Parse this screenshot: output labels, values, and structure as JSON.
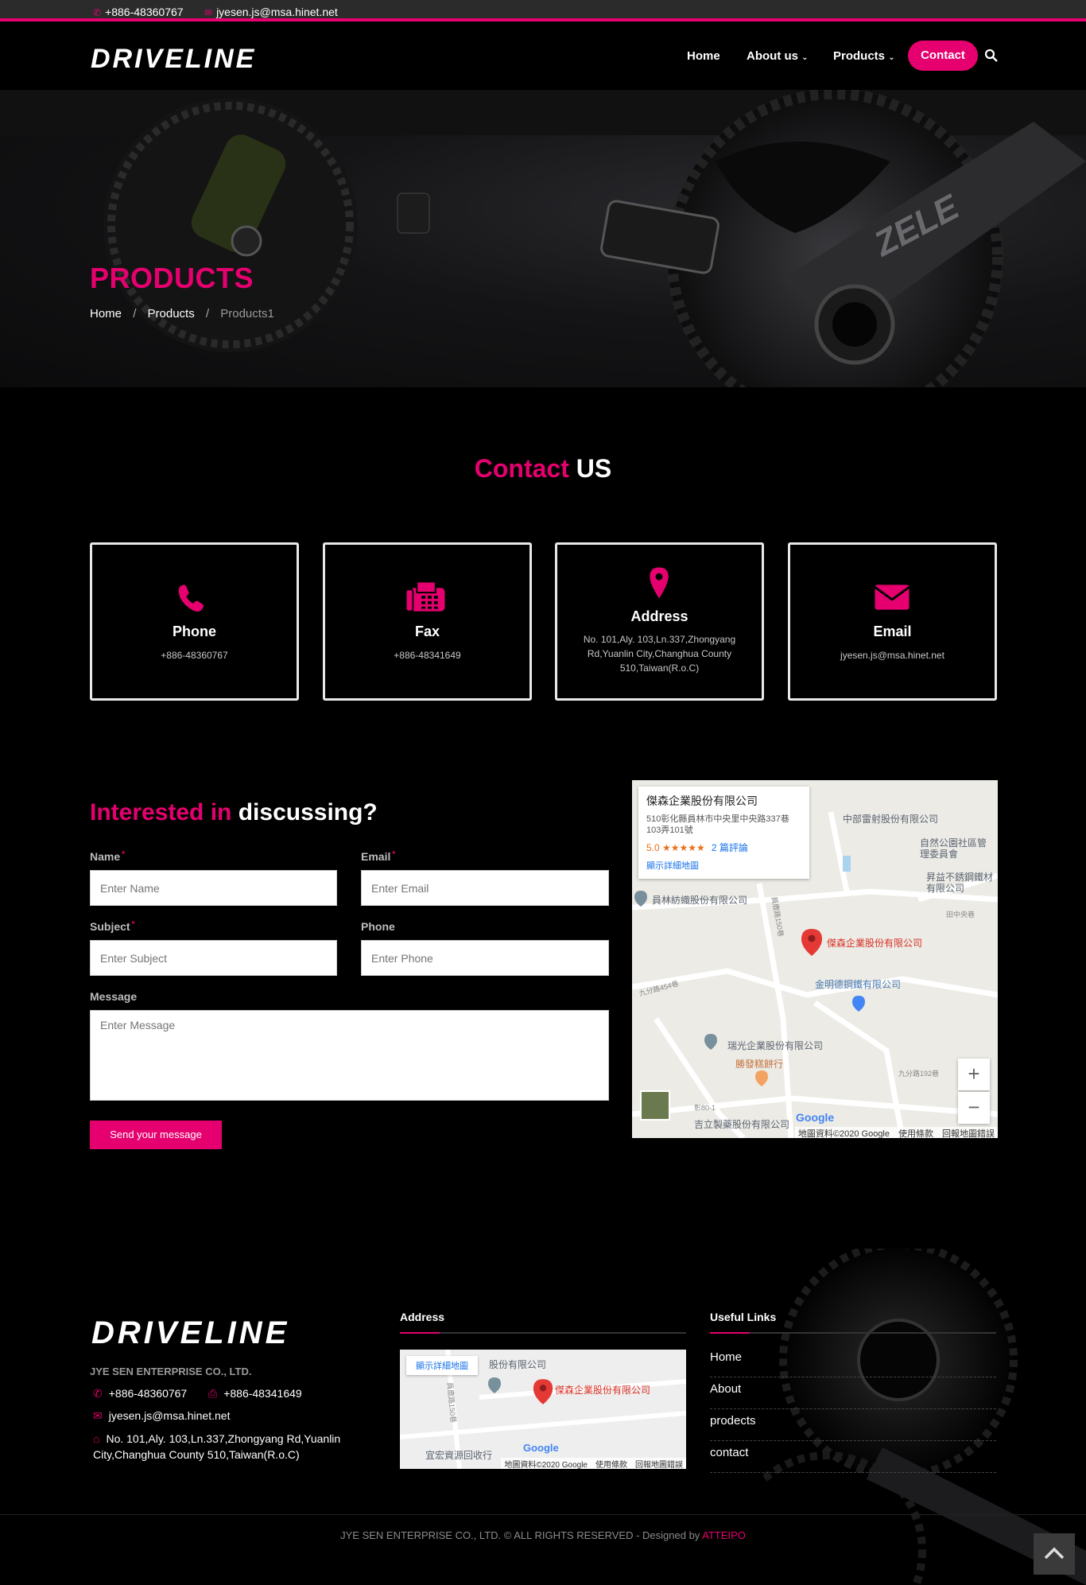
{
  "topbar": {
    "phone": "+886-48360767",
    "email": "jyesen.js@msa.hinet.net"
  },
  "header": {
    "logo_text": "DRIVELINE",
    "nav": {
      "home": "Home",
      "about": "About us",
      "products": "Products",
      "contact": "Contact"
    }
  },
  "hero": {
    "title": "PRODUCTS",
    "breadcrumb": [
      "Home",
      "Products",
      "Products1"
    ],
    "separator": "/"
  },
  "contact_heading": {
    "accent": "Contact",
    "rest": "US"
  },
  "cards": [
    {
      "title": "Phone",
      "value": "+886-48360767",
      "icon": "phone-icon"
    },
    {
      "title": "Fax",
      "value": "+886-48341649",
      "icon": "fax-icon"
    },
    {
      "title": "Address",
      "value": "No. 101,Aly. 103,Ln.337,Zhongyang Rd,Yuanlin City,Changhua County 510,Taiwan(R.o.C)",
      "icon": "map-pin-icon"
    },
    {
      "title": "Email",
      "value": "jyesen.js@msa.hinet.net",
      "icon": "envelope-icon"
    }
  ],
  "form": {
    "heading_accent": "Interested in",
    "heading_rest": "discussing?",
    "name_label": "Name",
    "name_placeholder": "Enter Name",
    "email_label": "Email",
    "email_placeholder": "Enter Email",
    "subject_label": "Subject",
    "subject_placeholder": "Enter Subject",
    "phone_label": "Phone",
    "phone_placeholder": "Enter Phone",
    "message_label": "Message",
    "message_placeholder": "Enter Message",
    "required_mark": "*",
    "submit": "Send your message"
  },
  "map": {
    "place_name": "傑森企業股份有限公司",
    "place_address": "510彰化縣員林市中央里中央路337巷103弄101號",
    "rating": "5.0 ★★★★★",
    "reviews": "2 篇評論",
    "details_link": "顯示詳細地圖",
    "labels": {
      "zhongbu": "中部雷射股份有限公司",
      "ziran": "自然公園社區管理委員會",
      "shengyi": "昇益不銹鋼鐵材有限公司",
      "tianzhong": "田中央巷",
      "yuanlin": "員林紡織股份有限公司",
      "marker": "傑森企業股份有限公司",
      "jinming": "金明德鋼鐵有限公司",
      "ruiguang": "瑞光企業股份有限公司",
      "shengfa": "勝發糕餅行",
      "jili": "吉立製藥股份有限公司"
    },
    "roads": {
      "r1": "員鹿路150巷",
      "r2": "九分路454巷",
      "r3": "九分路192巷",
      "r4": "彰80-1"
    },
    "zoom_in": "+",
    "zoom_out": "−",
    "google": "Google",
    "footer_text": "地圖資料©2020 Google　使用條款　回報地圖錯誤"
  },
  "footer": {
    "logo_text": "DRIVELINE",
    "company": "JYE SEN ENTERPRISE CO., LTD.",
    "phone": "+886-48360767",
    "fax": "+886-48341649",
    "email": "jyesen.js@msa.hinet.net",
    "address": "No. 101,Aly. 103,Ln.337,Zhongyang Rd,Yuanlin City,Changhua County 510,Taiwan(R.o.C)",
    "address_title": "Address",
    "mini_map": {
      "details_link": "顯示詳細地圖",
      "partial": "股份有限公司",
      "marker": "傑森企業股份有限公司",
      "road": "員鹿路150巷",
      "bottom": "宜宏資源回收行",
      "google": "Google",
      "footer_text": "地圖資料©2020 Google　使用條款　回報地圖錯誤"
    },
    "links_title": "Useful Links",
    "links": [
      "Home",
      "About",
      "prodects",
      "contact"
    ],
    "copyright_text": "JYE SEN ENTERPRISE CO., LTD. © ALL RIGHTS RESERVED - Designed by",
    "designer": "ATTEIPO"
  },
  "colors": {
    "accent": "#e6006f",
    "background": "#000000",
    "topbar": "#2b2b2b"
  }
}
